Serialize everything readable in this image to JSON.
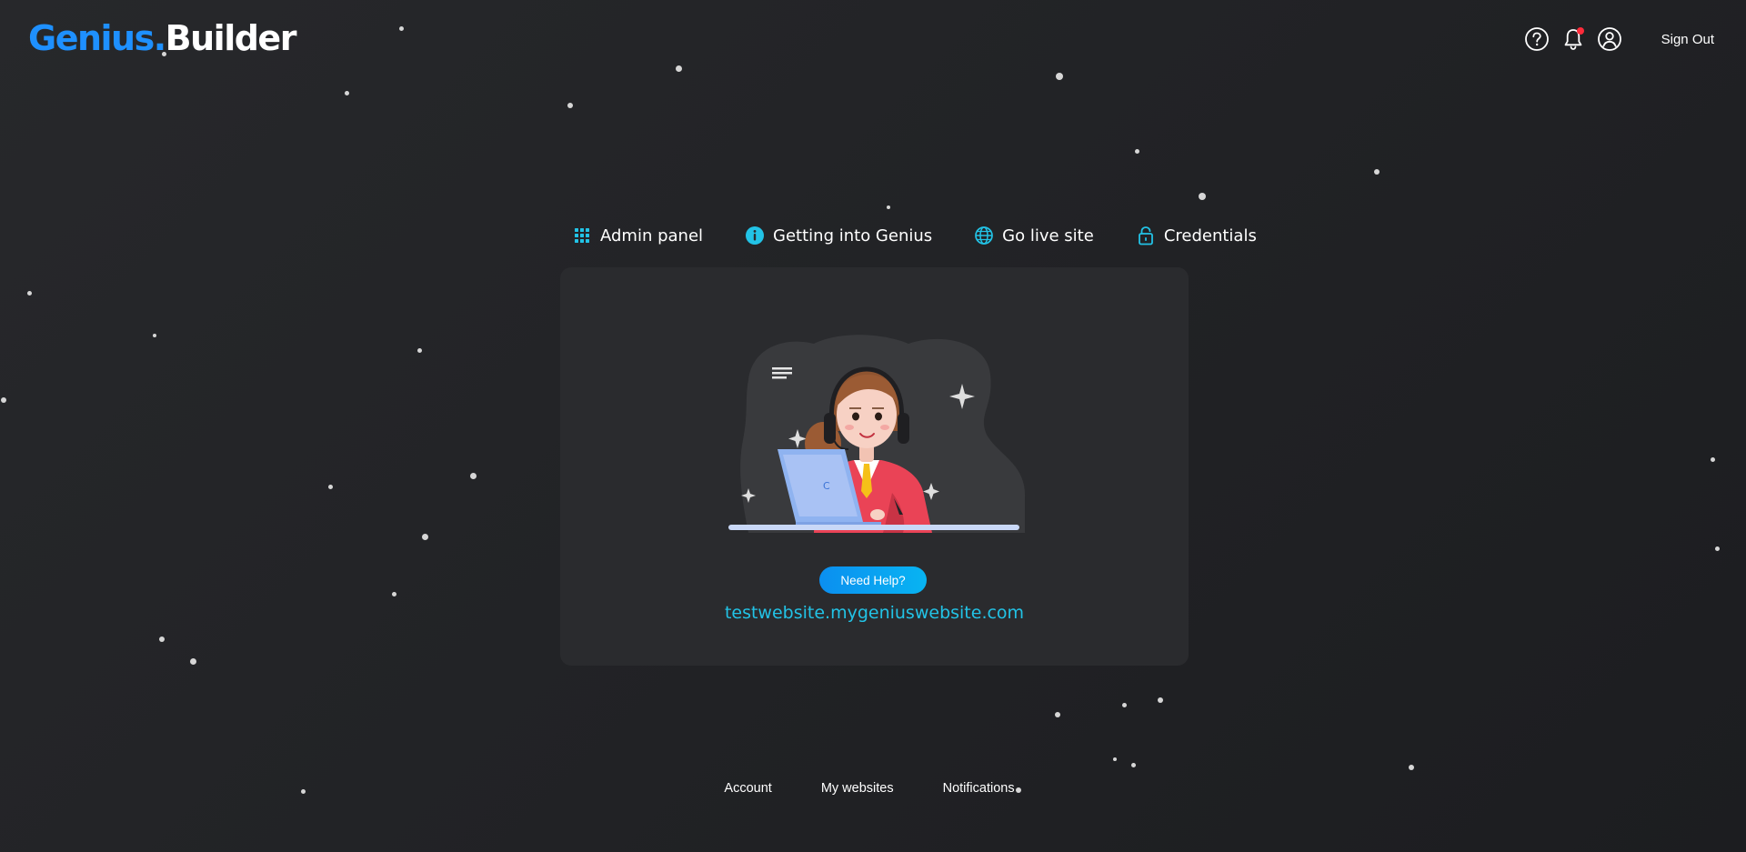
{
  "brand": {
    "logo_part1": "Genius",
    "logo_dot": ".",
    "logo_part2": "Builder",
    "accent_color": "#1e90ff"
  },
  "header": {
    "icons": [
      "help-icon",
      "bell-icon",
      "user-icon"
    ],
    "notification_badge_color": "#ff2b3a",
    "sign_out_label": "Sign Out"
  },
  "tabs": [
    {
      "label": "Admin panel",
      "icon": "grid-icon"
    },
    {
      "label": "Getting into Genius",
      "icon": "info-icon"
    },
    {
      "label": "Go live site",
      "icon": "globe-icon"
    },
    {
      "label": "Credentials",
      "icon": "lock-icon"
    }
  ],
  "card": {
    "illustration": "support-agent-illustration",
    "help_button_label": "Need Help?",
    "site_url": "testwebsite.mygeniuswebsite.com",
    "link_color": "#22c3e6",
    "button_color": "#0b8ff0"
  },
  "footer": {
    "links": [
      "Account",
      "My websites",
      "Notifications"
    ]
  }
}
